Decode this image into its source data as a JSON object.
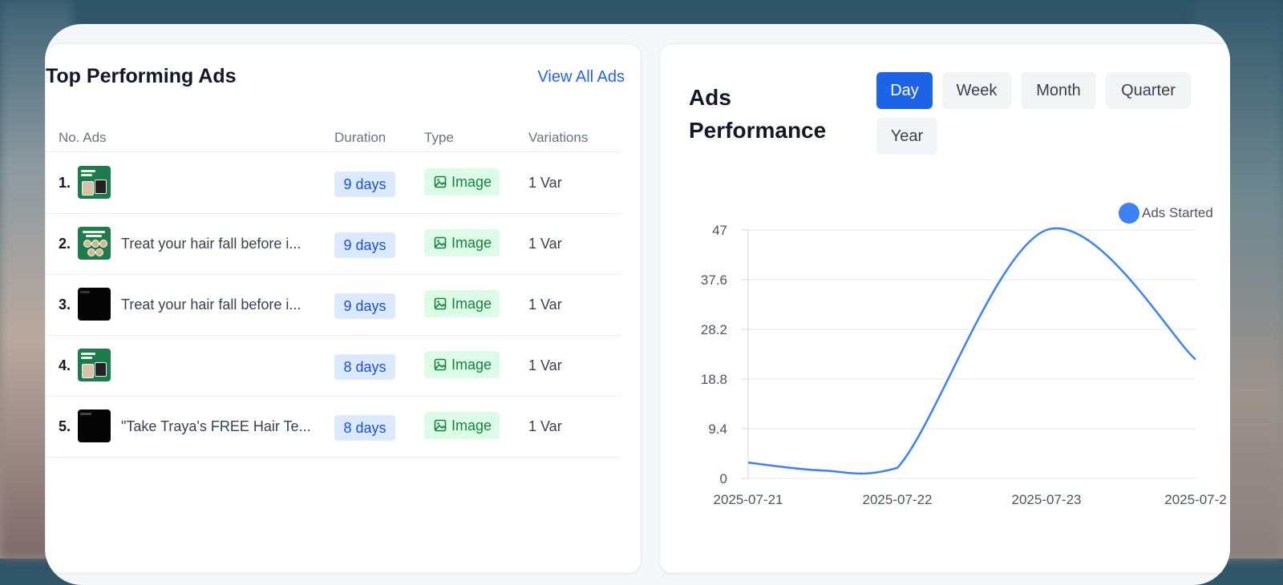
{
  "ads_panel": {
    "title": "Top Performing Ads",
    "view_all": "View All Ads",
    "columns": [
      "No. Ads",
      "Duration",
      "Type",
      "Variations"
    ],
    "rows": [
      {
        "num": "1.",
        "text": "",
        "duration": "9 days",
        "type": "Image",
        "variations": "1 Var",
        "thumb": "green"
      },
      {
        "num": "2.",
        "text": "Treat your hair fall before i...",
        "duration": "9 days",
        "type": "Image",
        "variations": "1 Var",
        "thumb": "green"
      },
      {
        "num": "3.",
        "text": "Treat your hair fall before i...",
        "duration": "9 days",
        "type": "Image",
        "variations": "1 Var",
        "thumb": "black"
      },
      {
        "num": "4.",
        "text": "",
        "duration": "8 days",
        "type": "Image",
        "variations": "1 Var",
        "thumb": "green"
      },
      {
        "num": "5.",
        "text": "\"Take Traya's FREE Hair Te...",
        "duration": "8 days",
        "type": "Image",
        "variations": "1 Var",
        "thumb": "black"
      }
    ]
  },
  "performance_panel": {
    "title": "Ads Performance",
    "ranges": [
      "Day",
      "Week",
      "Month",
      "Quarter",
      "Year"
    ],
    "active_range": "Day"
  },
  "colors": {
    "accent": "#1d63e6",
    "line": "#3b82f6",
    "duration_bg": "#dbeafe",
    "type_bg": "#dcfce7"
  },
  "chart_data": {
    "type": "line",
    "series": [
      {
        "name": "Ads Started",
        "values": [
          3.0,
          1.5,
          2.0,
          47.0,
          22.5
        ]
      }
    ],
    "x": [
      "2025-07-21",
      "2025-07-21T12",
      "2025-07-22",
      "2025-07-23",
      "2025-07-24"
    ],
    "x_tick_labels": [
      "2025-07-21",
      "2025-07-22",
      "2025-07-23",
      "2025-07-2"
    ],
    "y_ticks": [
      "0",
      "9.4",
      "18.8",
      "28.2",
      "37.6",
      "47"
    ],
    "ylim": [
      0,
      47
    ],
    "grid": true,
    "legend": "top-right",
    "smooth": true
  }
}
